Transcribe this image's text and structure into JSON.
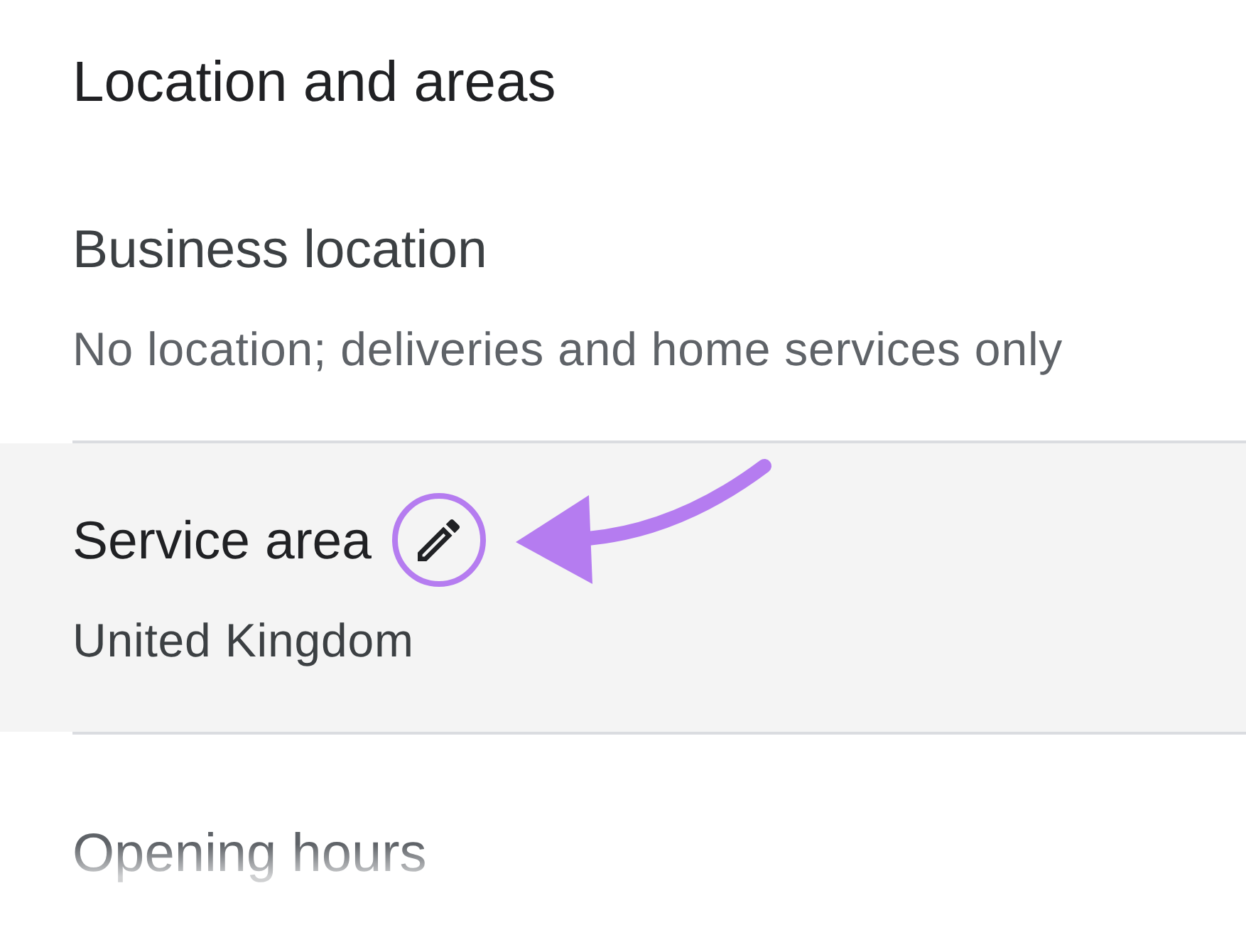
{
  "section": {
    "title": "Location and areas"
  },
  "items": [
    {
      "title": "Business location",
      "value": "No location; deliveries and home services only",
      "highlighted": false,
      "editable": false,
      "annotated": false
    },
    {
      "title": "Service area",
      "value": "United Kingdom",
      "highlighted": true,
      "editable": true,
      "annotated": true
    }
  ],
  "faded_item": {
    "title": "Opening hours"
  }
}
